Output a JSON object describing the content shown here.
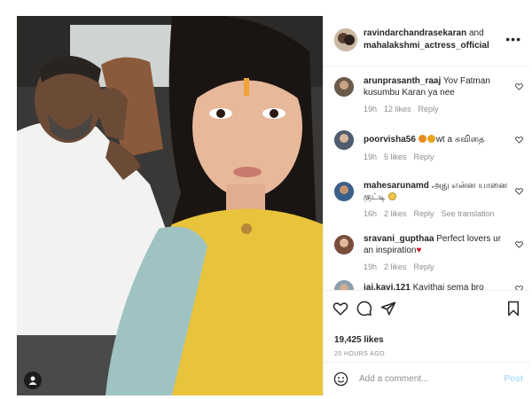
{
  "header": {
    "user1": "ravindarchandrasekaran",
    "joiner": " and",
    "user2": "mahalakshmi_actress_official",
    "more_icon": "more-horizontal-icon"
  },
  "comments": [
    {
      "user": "arunprasanth_raaj",
      "text": "Yov Fatman kusumbu Karan ya nee",
      "time": "19h",
      "likes": "12 likes",
      "reply": "Reply",
      "avatar_color": "#6b5a4a"
    },
    {
      "user": "poorvisha56",
      "text": "wt a கவிதை",
      "emoji": [
        "#e98a1c",
        "#e9a21c"
      ],
      "time": "19h",
      "likes": "5 likes",
      "reply": "Reply",
      "avatar_color": "#4e5c6e"
    },
    {
      "user": "mahesarunamd",
      "text": "அது என்ன யானை குட்டி",
      "emoji_end": "#f2c94c",
      "time": "16h",
      "likes": "2 likes",
      "reply": "Reply",
      "translation": "See translation",
      "avatar_color": "#3a5f8a"
    },
    {
      "user": "sravani_gupthaa",
      "text": "Perfect lovers ur an inspiration",
      "emoji_end": "#d0182a",
      "time": "19h",
      "likes": "2 likes",
      "reply": "Reply",
      "avatar_color": "#7a4d3a"
    },
    {
      "user": "jai.kavi.121",
      "text": "Kavithai sema bro",
      "avatar_color": "#8da0b0"
    }
  ],
  "actions": {
    "like_icon": "heart-icon",
    "comment_icon": "comment-icon",
    "share_icon": "send-icon",
    "save_icon": "bookmark-icon"
  },
  "likes": "19,425 likes",
  "time_ago": "20 HOURS AGO",
  "add_comment": {
    "placeholder": "Add a comment...",
    "post_label": "Post",
    "emoji_icon": "emoji-icon"
  },
  "colors": {
    "post_button": "#b2dffc",
    "meta_text": "#8e8e8e",
    "primary_text": "#262626"
  }
}
